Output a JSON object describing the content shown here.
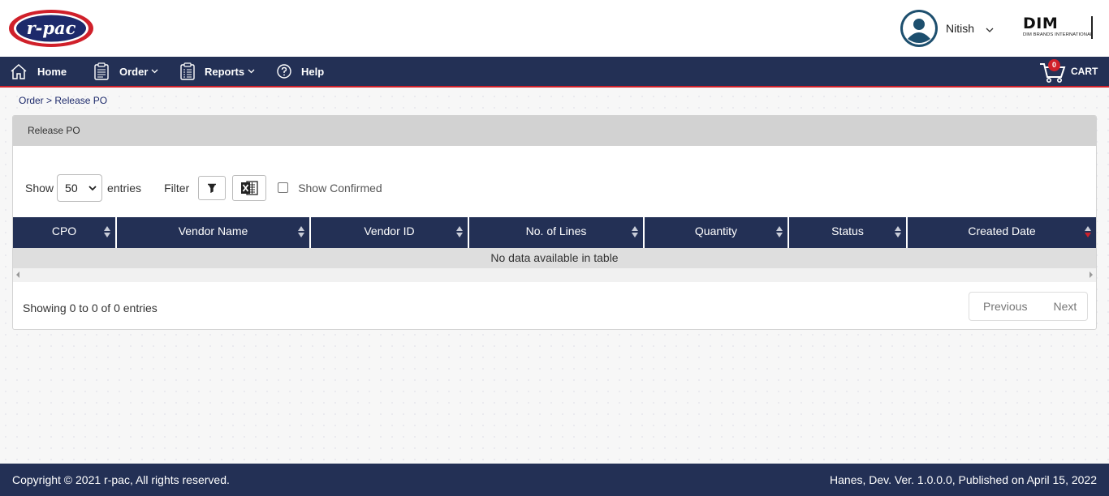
{
  "header": {
    "brand_logo_text": "r-pac",
    "user_name": "Nitish",
    "partner_logo_text": "DIM",
    "partner_logo_subtext": "DIM BRANDS INTERNATIONAL"
  },
  "nav": {
    "items": [
      {
        "label": "Home",
        "icon": "home-icon"
      },
      {
        "label": "Order",
        "icon": "clipboard-icon"
      },
      {
        "label": "Reports",
        "icon": "report-icon"
      },
      {
        "label": "Help",
        "icon": "help-icon"
      }
    ],
    "cart_label": "CART",
    "cart_count": "0"
  },
  "breadcrumb": {
    "parent": "Order",
    "separator": ">",
    "current": "Release PO"
  },
  "panel": {
    "title": "Release PO",
    "show_label": "Show",
    "entries_value": "50",
    "entries_label": "entries",
    "filter_label": "Filter",
    "show_confirmed_label": "Show Confirmed"
  },
  "table": {
    "columns": [
      "CPO",
      "Vendor Name",
      "Vendor ID",
      "No. of Lines",
      "Quantity",
      "Status",
      "Created Date"
    ],
    "empty_message": "No data available in table",
    "info": "Showing 0 to 0 of 0 entries",
    "prev_label": "Previous",
    "next_label": "Next"
  },
  "footer": {
    "copyright": "Copyright © 2021 r-pac, All rights reserved.",
    "version": "Hanes, Dev. Ver. 1.0.0.0, Published on April 15, 2022"
  },
  "colors": {
    "navy": "#233055",
    "accent_red": "#d0202a"
  }
}
